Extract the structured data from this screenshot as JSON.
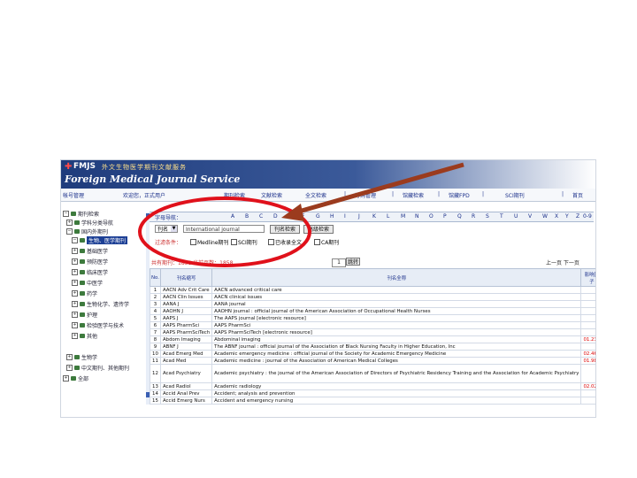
{
  "colors": {
    "banner": "#1f3c7c",
    "annotation_red": "#e0111b",
    "annotation_arrow": "#9b3b1e",
    "selection": "#1c3f95"
  },
  "header": {
    "logo_abbr": "FMJS",
    "logo_cn": "外文生物医学期刊文献服务",
    "logo_en": "Foreign Medical Journal Service"
  },
  "topbar": {
    "left": "帐号管理",
    "welcome": "欢迎您，正式用户",
    "links": [
      "期刊检索",
      "文献检索",
      "全文检索",
      "|",
      "订购管理",
      "|",
      "馆藏检索",
      "|",
      "馆藏FPD",
      "|",
      "SCI期刊",
      "|",
      "首页"
    ]
  },
  "sidebar": {
    "items": [
      {
        "label": "期刊检索",
        "level": 0,
        "icon": "folder-icon"
      },
      {
        "label": "学科分类导航",
        "level": 1,
        "icon": "folder-icon"
      },
      {
        "label": "国内外期刊",
        "level": 1,
        "icon": "folder-icon"
      },
      {
        "label": "生物、医学期刊",
        "level": 2,
        "icon": "folder-icon",
        "selected": true
      },
      {
        "label": "基础医学",
        "level": 2,
        "icon": "folder-icon"
      },
      {
        "label": "预防医学",
        "level": 2,
        "icon": "folder-icon"
      },
      {
        "label": "临床医学",
        "level": 2,
        "icon": "folder-icon"
      },
      {
        "label": "中医学",
        "level": 2,
        "icon": "folder-icon"
      },
      {
        "label": "药学",
        "level": 2,
        "icon": "folder-icon"
      },
      {
        "label": "生物化学、遗传学",
        "level": 2,
        "icon": "folder-icon"
      },
      {
        "label": "护理",
        "level": 2,
        "icon": "folder-icon"
      },
      {
        "label": "检验医学与技术",
        "level": 2,
        "icon": "folder-icon"
      },
      {
        "label": "其他",
        "level": 2,
        "icon": "folder-icon"
      },
      {
        "label": "生物学",
        "level": 1,
        "icon": "folder-icon"
      },
      {
        "label": "中文期刊、其他期刊",
        "level": 1,
        "icon": "folder-icon"
      },
      {
        "label": "全部",
        "level": 0,
        "icon": "folder-icon"
      }
    ]
  },
  "alpha": {
    "label": "字母导航：",
    "letters": [
      "A",
      "B",
      "C",
      "D",
      "E",
      "F",
      "G",
      "H",
      "I",
      "J",
      "K",
      "L",
      "M",
      "N",
      "O",
      "P",
      "Q",
      "R",
      "S",
      "T",
      "U",
      "V",
      "W",
      "X",
      "Y",
      "Z",
      "0-9"
    ]
  },
  "search": {
    "field_value": "刊名",
    "input_value": "International journal",
    "search_button": "刊名检索",
    "advanced_button": "高级检索"
  },
  "filters": {
    "label": "过滤条件：",
    "options": [
      "Medline期刊",
      "SCI期刊",
      "已收录全文",
      "CA期刊"
    ]
  },
  "status": {
    "count": "共有期刊：1858  当前页数：1858",
    "page_value": "1",
    "go_button": "跳转",
    "pager": "上一页  下一页"
  },
  "table": {
    "headers": [
      "No.",
      "刊名缩写",
      "刊名全称",
      "影响因子"
    ],
    "rows": [
      {
        "no": "1",
        "abbr": "AACN Adv Crit Care",
        "full": "AACN advanced critical care",
        "ind": ""
      },
      {
        "no": "2",
        "abbr": "AACN Clin Issues",
        "full": "AACN clinical issues",
        "ind": ""
      },
      {
        "no": "3",
        "abbr": "AANA J",
        "full": "AANA journal",
        "ind": ""
      },
      {
        "no": "4",
        "abbr": "AAOHN J",
        "full": "AAOHN journal : official journal of the American Association of Occupational Health Nurses",
        "ind": ""
      },
      {
        "no": "5",
        "abbr": "AAPS J",
        "full": "The AAPS journal [electronic resource]",
        "ind": "↓"
      },
      {
        "no": "6",
        "abbr": "AAPS PharmSci",
        "full": "AAPS PharmSci",
        "ind": ""
      },
      {
        "no": "7",
        "abbr": "AAPS PharmSciTech",
        "full": "AAPS PharmSciTech [electronic resource]",
        "ind": "↓"
      },
      {
        "no": "8",
        "abbr": "Abdom Imaging",
        "full": "Abdominal imaging",
        "ind": "01.235"
      },
      {
        "no": "9",
        "abbr": "ABNF J",
        "full": "The ABNF journal : official journal of the Association of Black Nursing Faculty in Higher Education, Inc",
        "ind": ""
      },
      {
        "no": "10",
        "abbr": "Acad Emerg Med",
        "full": "Academic emergency medicine : official journal of the Society for Academic Emergency Medicine",
        "ind": "02.460"
      },
      {
        "no": "11",
        "abbr": "Acad Med",
        "full": "Academic medicine : journal of the Association of American Medical Colleges",
        "ind": "01.985"
      },
      {
        "no": "12",
        "abbr": "Acad Psychiatry",
        "full": "Academic psychiatry : the journal of the American Association of Directors of Psychiatric Residency Training and the Association for Academic Psychiatry",
        "ind": "",
        "tall": true
      },
      {
        "no": "13",
        "abbr": "Acad Radiol",
        "full": "Academic radiology",
        "ind": "02.021"
      },
      {
        "no": "14",
        "abbr": "Accid Anal Prev",
        "full": "Accident; analysis and prevention",
        "ind": ""
      },
      {
        "no": "15",
        "abbr": "Accid Emerg Nurs",
        "full": "Accident and emergency nursing",
        "ind": ""
      }
    ]
  }
}
